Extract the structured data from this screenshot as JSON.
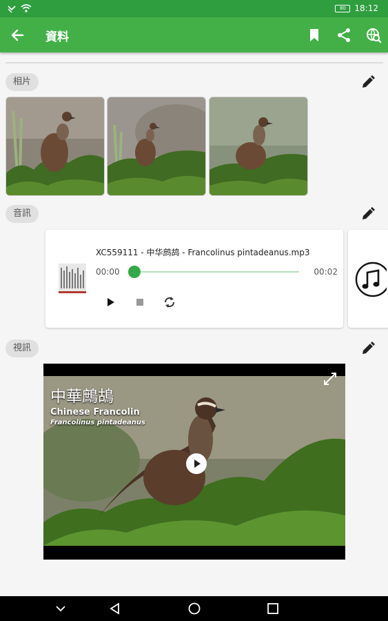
{
  "status": {
    "time": "18:12",
    "battery": "80"
  },
  "appbar": {
    "title": "資料"
  },
  "sections": {
    "photos": {
      "label": "相片"
    },
    "audio": {
      "label": "音訊",
      "file_name": "XC559111 - 中华鹧鸪 - Francolinus pintadeanus.mp3",
      "current_time": "00:00",
      "duration": "00:02",
      "progress": 0
    },
    "video": {
      "label": "視訊",
      "overlay_cn": "中華鷓鴣",
      "overlay_en": "Chinese Francolin",
      "overlay_sci": "Francolinus pintadeanus"
    }
  },
  "colors": {
    "status_bar": "#2e9e3f",
    "app_bar": "#43b047",
    "accent": "#33a848"
  }
}
